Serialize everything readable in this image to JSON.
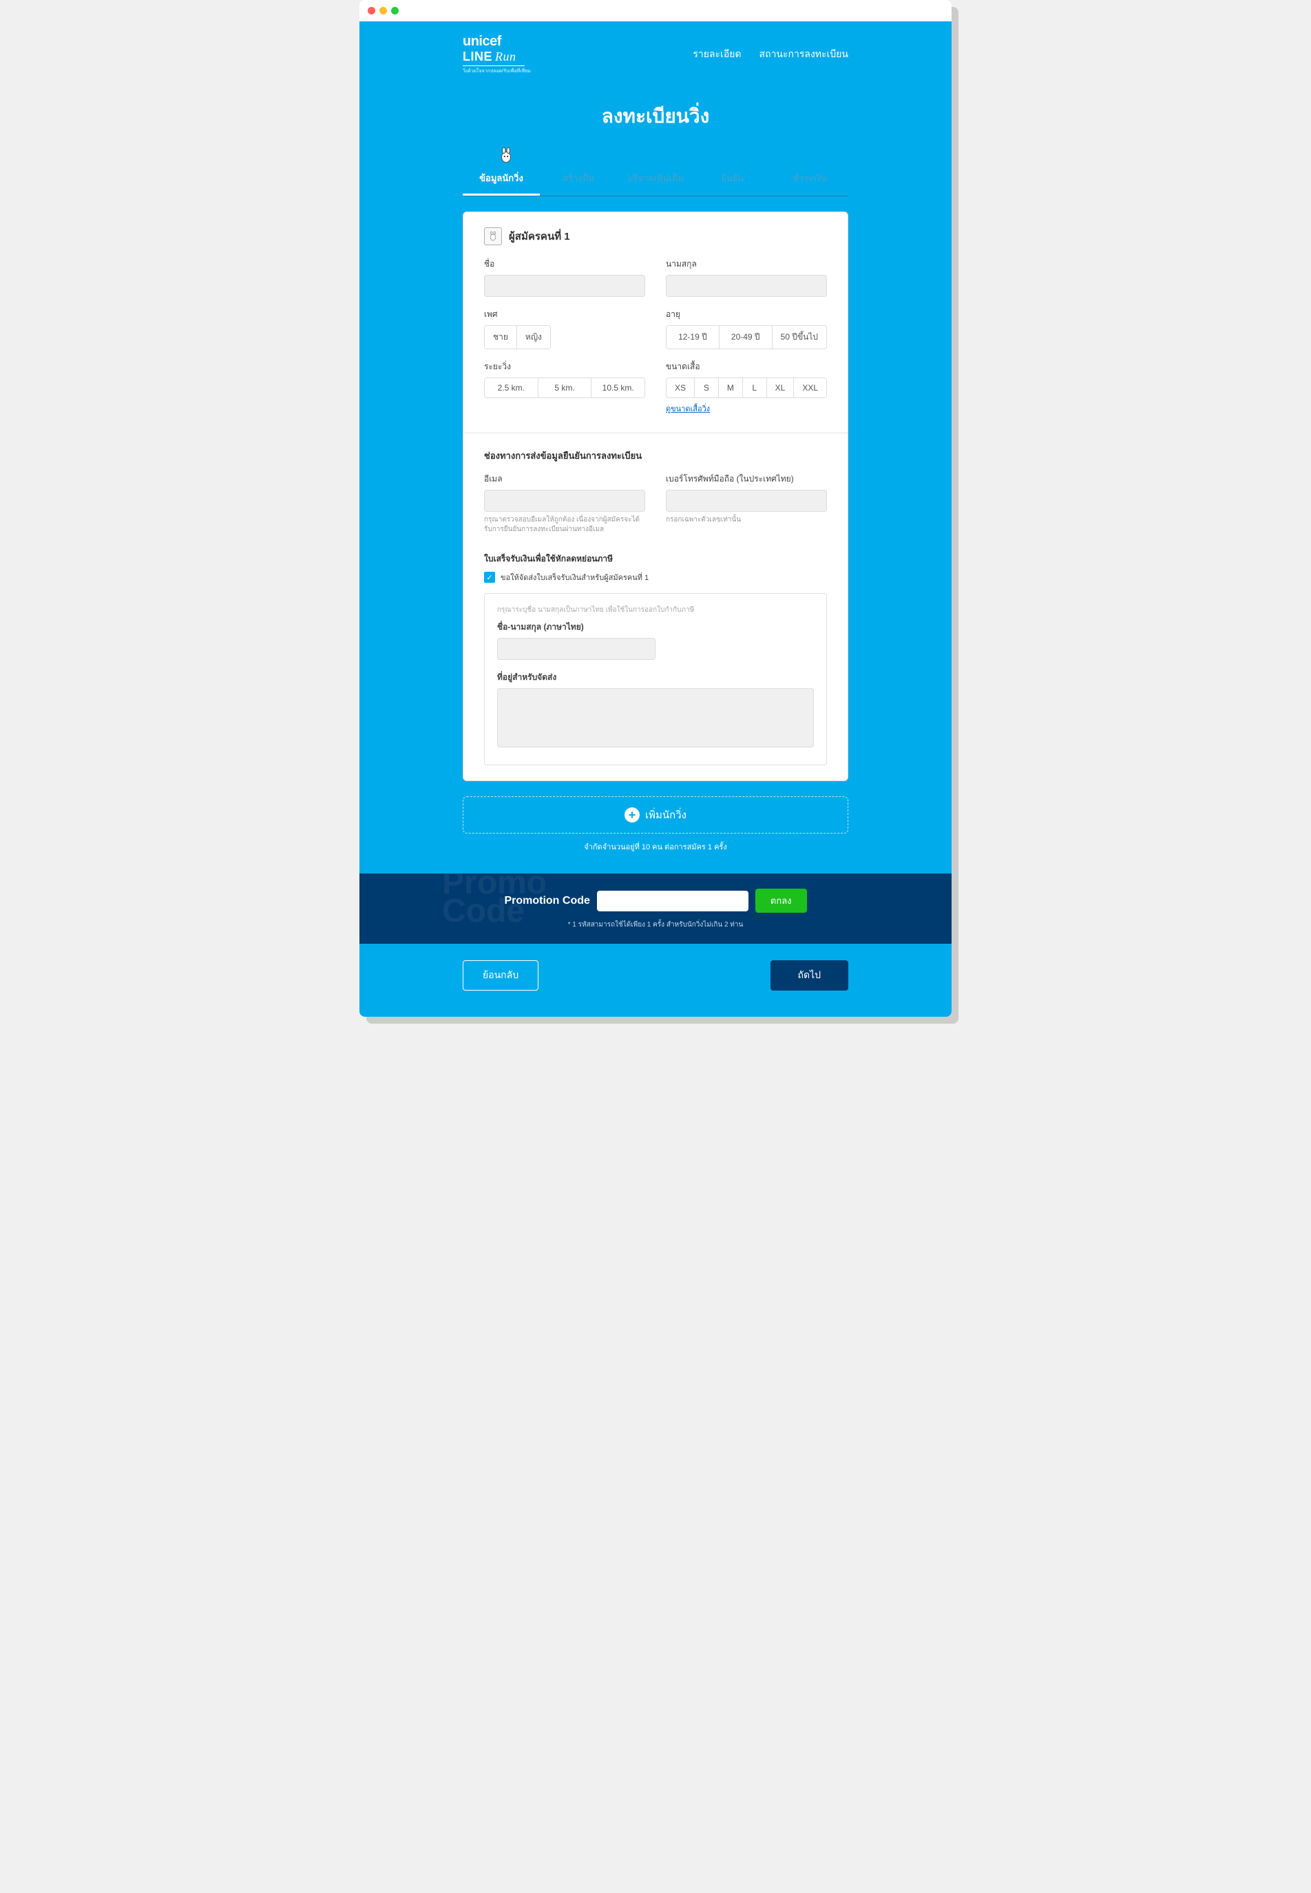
{
  "nav": {
    "details": "รายละเอียด",
    "status": "สถานะการลงทะเบียน"
  },
  "logo": {
    "line1": "unicef",
    "line2a": "LINE",
    "line2b": "Run",
    "line3": "วิ่งด้วยใจจากปลอด/รับเพื่อที่เทียม"
  },
  "title": "ลงทะเบียนวิ่ง",
  "tabs": {
    "t1": "ข้อมูลนักวิ่ง",
    "t2": "สร้างทีม",
    "t3": "บริจาคเพิ่มเติม",
    "t4": "ยืนยัน",
    "t5": "ชำระเงิน"
  },
  "section1": {
    "title": "ผู้สมัครคนที่ 1",
    "firstname": "ชื่อ",
    "lastname": "นามสกุล",
    "gender": "เพศ",
    "genders": {
      "m": "ชาย",
      "f": "หญิง"
    },
    "age": "อายุ",
    "ages": {
      "a1": "12-19 ปี",
      "a2": "20-49 ปี",
      "a3": "50 ปีขึ้นไป"
    },
    "distance": "ระยะวิ่ง",
    "distances": {
      "d1": "2.5 km.",
      "d2": "5 km.",
      "d3": "10.5 km."
    },
    "shirt": "ขนาดเสื้อ",
    "sizes": {
      "xs": "XS",
      "s": "S",
      "m": "M",
      "l": "L",
      "xl": "XL",
      "xxl": "XXL"
    },
    "sizeLink": "ดูขนาดเสื้อวิ่ง"
  },
  "section2": {
    "title": "ช่องทางการส่งข้อมูลยืนยันการลงทะเบียน",
    "email": "อีเมล",
    "emailHelp": "กรุณาตรวจสอบอีเมลให้ถูกต้อง เนื่องจากผู้สมัครจะได้รับการยืนยันการลงทะเบียนผ่านทางอีเมล",
    "phone": "เบอร์โทรศัพท์มือถือ (ในประเทศไทย)",
    "phoneHelp": "กรอกเฉพาะตัวเลขเท่านั้น"
  },
  "section3": {
    "title": "ใบเสร็จรับเงินเพื่อใช้หักลดหย่อนภาษี",
    "checkbox": "ขอให้จัดส่งใบเสร็จรับเงินสำหรับผู้สมัครคนที่ 1",
    "hint": "กรุณาระบุชื่อ นามสกุลเป็นภาษาไทย เพื่อใช้ในการออกใบกำกับภาษี",
    "nameThai": "ชื่อ-นามสกุล (ภาษาไทย)",
    "address": "ที่อยู่สำหรับจัดส่ง"
  },
  "addRunner": "เพิ่มนักวิ่ง",
  "limitNote": "จำกัดจำนวนอยู่ที่ 10 คน ต่อการสมัคร 1 ครั้ง",
  "promo": {
    "bg1": "Promo",
    "bg2": "Code",
    "label": "Promotion Code",
    "btn": "ตกลง",
    "note": "* 1 รหัสสามารถใช้ได้เพียง 1 ครั้ง สำหรับนักวิ่งไม่เกิน 2 ท่าน"
  },
  "footer": {
    "back": "ย้อนกลับ",
    "next": "ถัดไป"
  }
}
